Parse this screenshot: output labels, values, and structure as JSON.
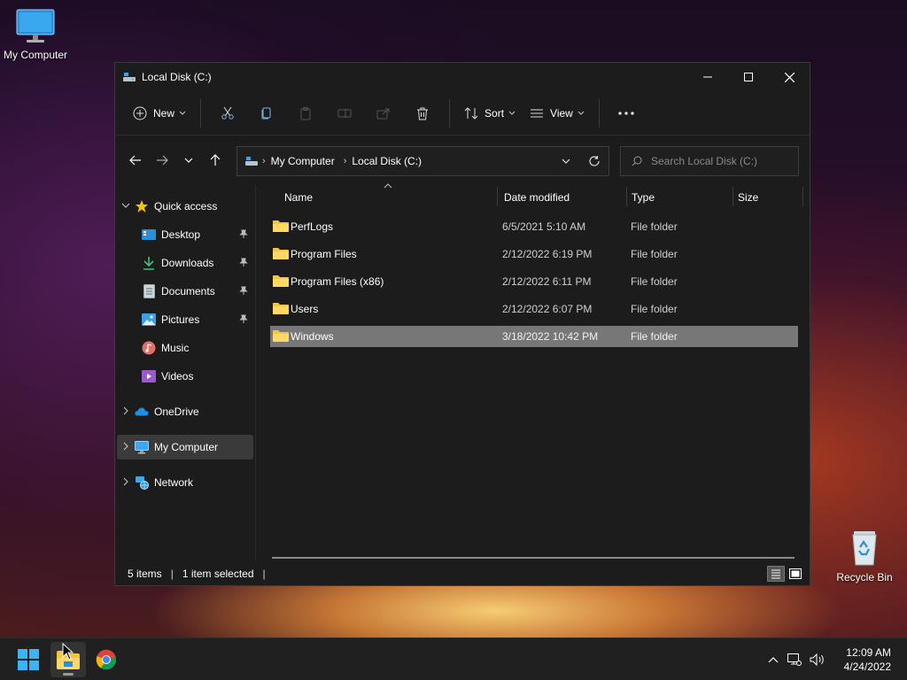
{
  "desktop": {
    "my_computer_label": "My Computer",
    "recycle_bin_label": "Recycle Bin"
  },
  "window": {
    "title": "Local Disk (C:)",
    "toolbar": {
      "new_label": "New",
      "sort_label": "Sort",
      "view_label": "View"
    },
    "address": {
      "crumbs": [
        "My Computer",
        "Local Disk (C:)"
      ]
    },
    "search": {
      "placeholder": "Search Local Disk (C:)"
    },
    "sidebar": {
      "quick_access": "Quick access",
      "items": [
        "Desktop",
        "Downloads",
        "Documents",
        "Pictures",
        "Music",
        "Videos"
      ],
      "onedrive": "OneDrive",
      "my_computer": "My Computer",
      "network": "Network"
    },
    "columns": [
      "Name",
      "Date modified",
      "Type",
      "Size"
    ],
    "files": [
      {
        "name": "PerfLogs",
        "date": "6/5/2021 5:10 AM",
        "type": "File folder"
      },
      {
        "name": "Program Files",
        "date": "2/12/2022 6:19 PM",
        "type": "File folder"
      },
      {
        "name": "Program Files (x86)",
        "date": "2/12/2022 6:11 PM",
        "type": "File folder"
      },
      {
        "name": "Users",
        "date": "2/12/2022 6:07 PM",
        "type": "File folder"
      },
      {
        "name": "Windows",
        "date": "3/18/2022 10:42 PM",
        "type": "File folder"
      }
    ],
    "status": {
      "item_count": "5 items",
      "selected": "1 item selected"
    }
  },
  "taskbar": {
    "time": "12:09 AM",
    "date": "4/24/2022"
  },
  "colors": {
    "folder": "#f4c542",
    "accent": "#3a96dd"
  }
}
